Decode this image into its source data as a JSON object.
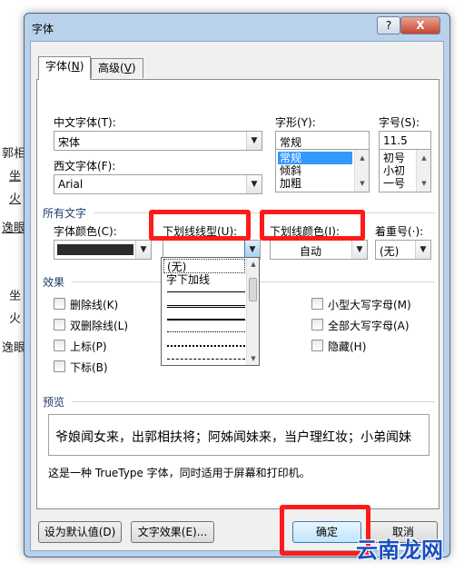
{
  "background_text": [
    "郭相",
    "坐",
    "火",
    "逸眼",
    "坐",
    "火",
    "逸眼"
  ],
  "dialog": {
    "title": "字体",
    "help_button": "?",
    "close_button": "X"
  },
  "tabs": [
    {
      "label": "字体",
      "accel": "N",
      "active": true
    },
    {
      "label": "高级",
      "accel": "V",
      "active": false
    }
  ],
  "font": {
    "chinese_font_label": "中文字体(T):",
    "chinese_font_value": "宋体",
    "western_font_label": "西文字体(F):",
    "western_font_value": "Arial",
    "style_label": "字形(Y):",
    "style_value": "常规",
    "style_options": [
      "常规",
      "倾斜",
      "加粗"
    ],
    "style_selected": "常规",
    "size_label": "字号(S):",
    "size_value": "11.5",
    "size_options": [
      "初号",
      "小初",
      "一号"
    ]
  },
  "all_text": {
    "section_label": "所有文字",
    "font_color_label": "字体颜色(C):",
    "font_color_value": "#2b2b2b",
    "underline_style_label": "下划线线型(U):",
    "underline_color_label": "下划线颜色(I):",
    "underline_color_value": "自动",
    "emphasis_label": "着重号(·):",
    "emphasis_value": "(无)"
  },
  "underline_dropdown": {
    "options": [
      "(无)",
      "字下加线"
    ]
  },
  "effects": {
    "section_label": "效果",
    "items": [
      {
        "label": "删除线(K)",
        "checked": false
      },
      {
        "label": "双删除线(L)",
        "checked": false
      },
      {
        "label": "上标(P)",
        "checked": false
      },
      {
        "label": "下标(B)",
        "checked": false
      },
      {
        "label": "小型大写字母(M)",
        "checked": false
      },
      {
        "label": "全部大写字母(A)",
        "checked": false
      },
      {
        "label": "隐藏(H)",
        "checked": false
      }
    ]
  },
  "preview": {
    "section_label": "预览",
    "sample_text": "爷娘闻女来，出郭相扶将；阿姊闻妹来，当户理红妆；小弟闻妹",
    "note": "这是一种 TrueType 字体，同时适用于屏幕和打印机。"
  },
  "buttons": {
    "set_default": "设为默认值(D)",
    "text_effects": "文字效果(E)...",
    "ok": "确定",
    "cancel": "取消"
  },
  "watermark": "云南龙网",
  "colors": {
    "highlight_box": "#ff1a1a",
    "selection": "#3399ff",
    "frame": "#b9d1ea"
  }
}
